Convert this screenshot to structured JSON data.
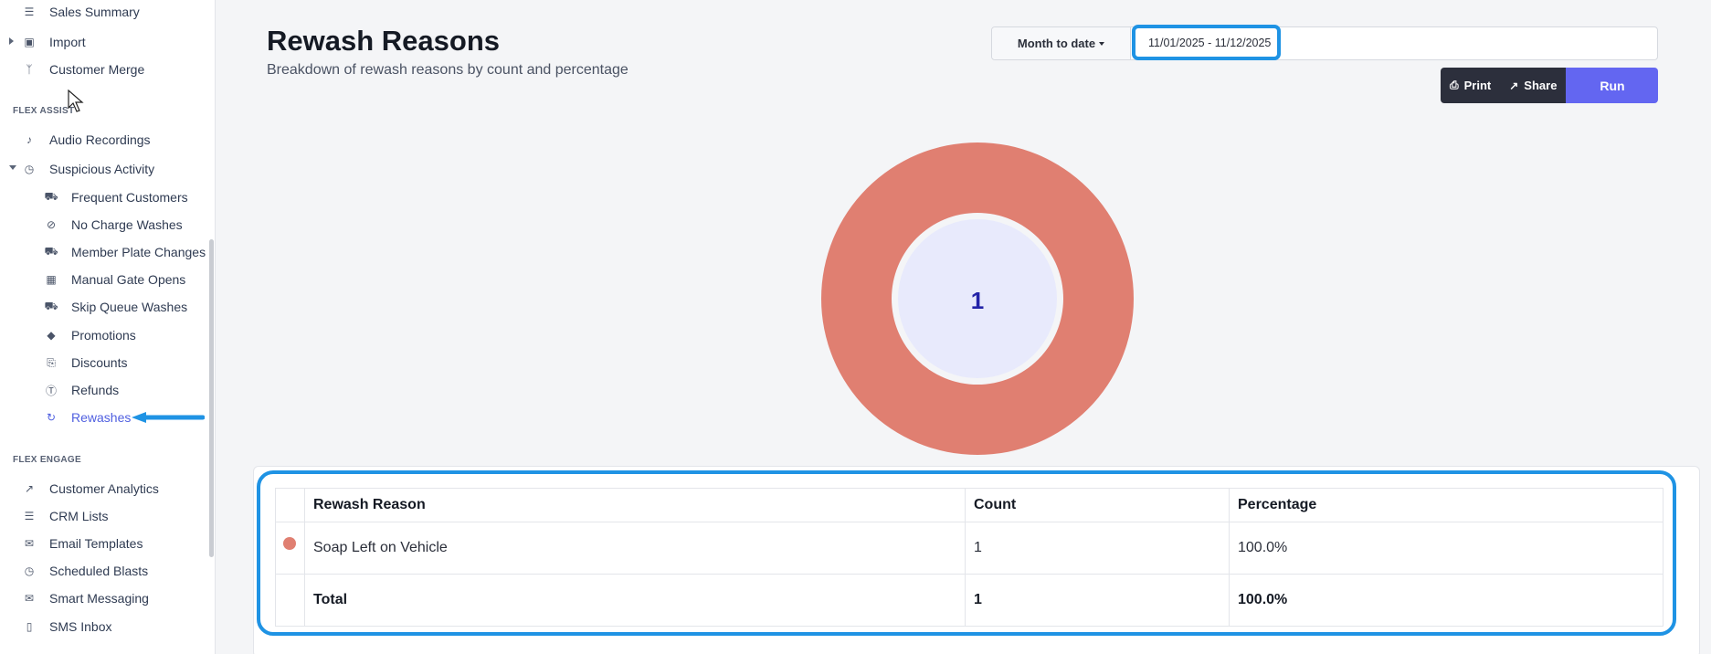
{
  "sidebar": {
    "items_top": [
      {
        "label": "Sales Summary"
      },
      {
        "label": "Import"
      },
      {
        "label": "Customer Merge"
      }
    ],
    "sections": {
      "flex_assist": "FLEX ASSIST",
      "flex_engage": "FLEX ENGAGE"
    },
    "assist_items": [
      {
        "label": "Audio Recordings"
      },
      {
        "label": "Suspicious Activity"
      }
    ],
    "suspicious_sub": [
      {
        "label": "Frequent Customers"
      },
      {
        "label": "No Charge Washes"
      },
      {
        "label": "Member Plate Changes"
      },
      {
        "label": "Manual Gate Opens"
      },
      {
        "label": "Skip Queue Washes"
      },
      {
        "label": "Promotions"
      },
      {
        "label": "Discounts"
      },
      {
        "label": "Refunds"
      },
      {
        "label": "Rewashes"
      }
    ],
    "engage_items": [
      {
        "label": "Customer Analytics"
      },
      {
        "label": "CRM Lists"
      },
      {
        "label": "Email Templates"
      },
      {
        "label": "Scheduled Blasts"
      },
      {
        "label": "Smart Messaging"
      },
      {
        "label": "SMS Inbox"
      }
    ]
  },
  "page": {
    "title": "Rewash Reasons",
    "subtitle": "Breakdown of rewash reasons by count and percentage"
  },
  "filters": {
    "range_label": "Month to date",
    "date_range": "11/01/2025 - 11/12/2025"
  },
  "actions": {
    "print": "Print",
    "share": "Share",
    "run": "Run"
  },
  "chart_data": {
    "type": "pie",
    "categories": [
      "Soap Left on Vehicle"
    ],
    "values": [
      1
    ],
    "center_label": "1",
    "colors": [
      "#e07f71"
    ]
  },
  "table": {
    "headers": [
      "Rewash Reason",
      "Count",
      "Percentage"
    ],
    "rows": [
      {
        "reason": "Soap Left on Vehicle",
        "count": "1",
        "percentage": "100.0%",
        "color": "#e07f71"
      }
    ],
    "total": {
      "label": "Total",
      "count": "1",
      "percentage": "100.0%"
    }
  },
  "colors": {
    "accent": "#6366f1",
    "highlight": "#1f93e4",
    "slice": "#e07f71"
  }
}
